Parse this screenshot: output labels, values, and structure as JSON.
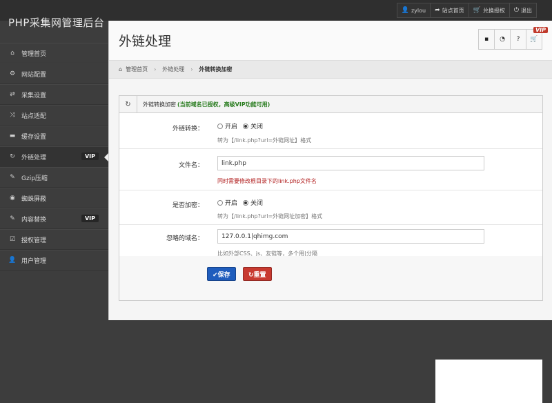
{
  "brand": "PHP采集网管理后台",
  "top_links": [
    {
      "icon": "user-icon",
      "glyph": "👤",
      "label": "zylou"
    },
    {
      "icon": "share-icon",
      "glyph": "➦",
      "label": "站点首页"
    },
    {
      "icon": "cart-icon",
      "glyph": "🛒",
      "label": "兑换授权"
    },
    {
      "icon": "power-icon",
      "glyph": "⏻",
      "label": "退出"
    }
  ],
  "sidebar": {
    "items": [
      {
        "id": "home",
        "icon": "home-icon",
        "glyph": "⌂",
        "label": "管理首页"
      },
      {
        "id": "site-config",
        "icon": "gear-icon",
        "glyph": "⚙",
        "label": "网站配置"
      },
      {
        "id": "collect",
        "icon": "retweet-icon",
        "glyph": "⇄",
        "label": "采集设置"
      },
      {
        "id": "adapt",
        "icon": "shuffle-icon",
        "glyph": "⤨",
        "label": "站点适配"
      },
      {
        "id": "cache",
        "icon": "folder-icon",
        "glyph": "▬",
        "label": "缓存设置"
      },
      {
        "id": "outlink",
        "icon": "refresh-icon",
        "glyph": "↻",
        "label": "外链处理",
        "vip": "VIP"
      },
      {
        "id": "gzip",
        "icon": "brush-icon",
        "glyph": "✎",
        "label": "Gzip压缩"
      },
      {
        "id": "spider",
        "icon": "eye-icon",
        "glyph": "◉",
        "label": "蜘蛛屏蔽"
      },
      {
        "id": "replace",
        "icon": "pencil-icon",
        "glyph": "✎",
        "label": "内容替换",
        "vip": "VIP"
      },
      {
        "id": "license",
        "icon": "check-icon",
        "glyph": "☑",
        "label": "授权管理"
      },
      {
        "id": "users",
        "icon": "user-icon",
        "glyph": "👤",
        "label": "用户管理"
      }
    ]
  },
  "page": {
    "title": "外链处理",
    "head_buttons": [
      {
        "icon": "comment-icon",
        "glyph": "▪"
      },
      {
        "icon": "clock-icon",
        "glyph": "◔"
      },
      {
        "icon": "question-icon",
        "glyph": "?"
      },
      {
        "icon": "cart-icon",
        "glyph": "🛒"
      }
    ],
    "vip_badge": "VIP"
  },
  "breadcrumb": {
    "home": "管理首页",
    "level2": "外链处理",
    "current": "外链转换加密"
  },
  "box": {
    "title": "外链转换加密",
    "note": "(当前域名已授权，高级VIP功能可用)"
  },
  "form": {
    "convert": {
      "label": "外链转换：",
      "opt_on": "开启",
      "opt_off": "关闭",
      "help": "转为【/link.php?url=外链网址】格式"
    },
    "filename": {
      "label": "文件名：",
      "value": "link.php",
      "help": "同时需要修改根目录下的link.php文件名"
    },
    "encrypt": {
      "label": "是否加密：",
      "opt_on": "开启",
      "opt_off": "关闭",
      "help": "转为【/link.php?url=外链网址加密】格式"
    },
    "ignore": {
      "label": "忽略的域名：",
      "value": "127.0.0.1|qhimg.com",
      "help": "比如外部CSS、js、友链等，多个用|分隔"
    }
  },
  "actions": {
    "save": "✔保存",
    "reset": "↻重置"
  },
  "colors": {
    "save": "#1f5dbd",
    "reset": "#c83a30",
    "note": "#2a7d20",
    "warning": "#b01b1b"
  }
}
